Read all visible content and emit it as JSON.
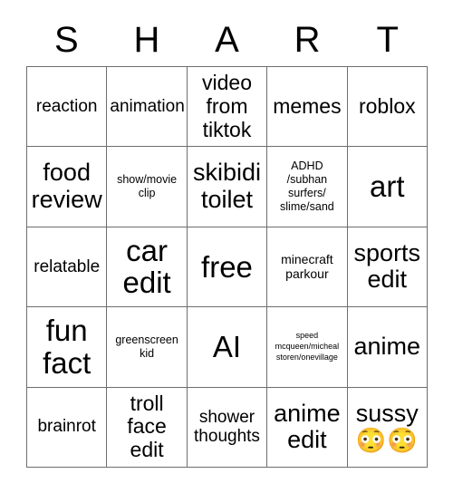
{
  "card": {
    "title_letters": [
      "S",
      "H",
      "A",
      "R",
      "T"
    ],
    "grid_size": "5x5",
    "colors": {
      "text": "#000000",
      "grid_line": "#6e6e6e",
      "background": "#ffffff"
    },
    "rows": [
      [
        {
          "text": "reaction",
          "size": "md"
        },
        {
          "text": "animation",
          "size": "md"
        },
        {
          "text": "video\nfrom\ntiktok",
          "size": "lg"
        },
        {
          "text": "memes",
          "size": "lg"
        },
        {
          "text": "roblox",
          "size": "lg"
        }
      ],
      [
        {
          "text": "food\nreview",
          "size": "xl"
        },
        {
          "text": "show/movie\nclip",
          "size": "xs"
        },
        {
          "text": "skibidi\ntoilet",
          "size": "xl"
        },
        {
          "text": "ADHD\n/subhan\nsurfers/\nslime/sand",
          "size": "xs"
        },
        {
          "text": "art",
          "size": "xxl"
        }
      ],
      [
        {
          "text": "relatable",
          "size": "md"
        },
        {
          "text": "car\nedit",
          "size": "xxl"
        },
        {
          "text": "free",
          "size": "xxl"
        },
        {
          "text": "minecraft\nparkour",
          "size": "sm"
        },
        {
          "text": "sports\nedit",
          "size": "xl"
        }
      ],
      [
        {
          "text": "fun\nfact",
          "size": "xxl"
        },
        {
          "text": "greenscreen\nkid",
          "size": "xs"
        },
        {
          "text": "AI",
          "size": "xxl"
        },
        {
          "text": "speed\nmcqueen/micheal\nstoren/onevillage",
          "size": "xxs"
        },
        {
          "text": "anime",
          "size": "xl"
        }
      ],
      [
        {
          "text": "brainrot",
          "size": "md"
        },
        {
          "text": "troll\nface\nedit",
          "size": "lg"
        },
        {
          "text": "shower\nthoughts",
          "size": "md"
        },
        {
          "text": "anime\nedit",
          "size": "xl"
        },
        {
          "text": "sussy",
          "size": "xl",
          "emoji": "😳😳"
        }
      ]
    ]
  }
}
